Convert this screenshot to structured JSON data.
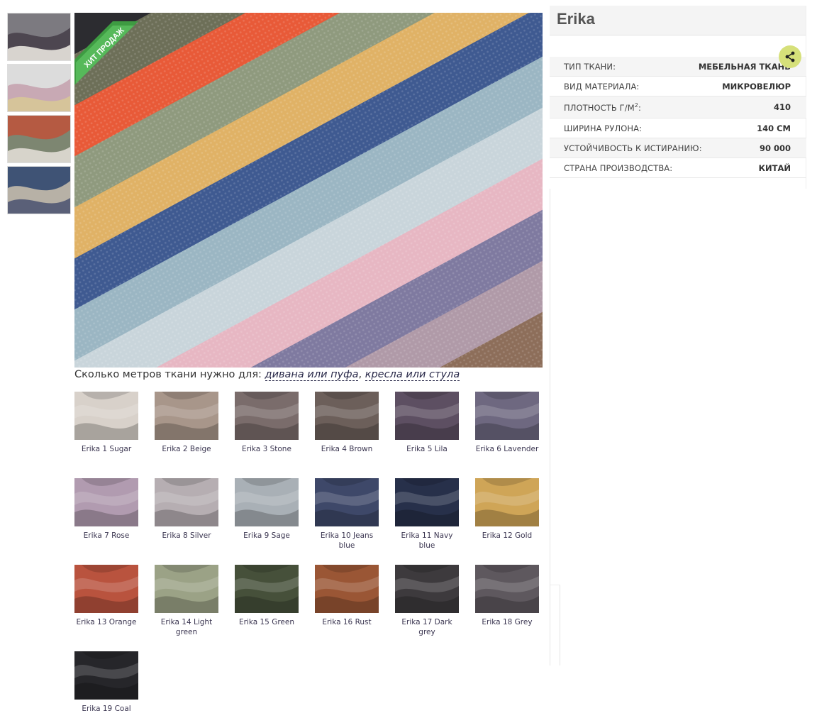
{
  "product": {
    "title": "Erika",
    "badge": "ХИТ ПРОДАЖ",
    "share_icon": "share-icon"
  },
  "thumbnails": [
    {
      "name": "thumb-1",
      "colors": [
        "#7c7a80",
        "#4d4650",
        "#d8d4cf"
      ]
    },
    {
      "name": "thumb-2",
      "colors": [
        "#dcdcdc",
        "#c8a9b4",
        "#d6c49a"
      ]
    },
    {
      "name": "thumb-3",
      "colors": [
        "#b55a42",
        "#7d8671",
        "#d7d4cb"
      ]
    },
    {
      "name": "thumb-4",
      "colors": [
        "#3f5375",
        "#b7b1a6",
        "#5a6078"
      ]
    }
  ],
  "main_stripes": [
    "#6d6f58",
    "#e85a38",
    "#8f9a7e",
    "#e0b266",
    "#3f5a91",
    "#9bb6c3",
    "#c9d5db",
    "#e7b7c3",
    "#7f7aa0",
    "#b09aa8",
    "#8d6e5a"
  ],
  "calculator": {
    "prefix": "Сколько метров ткани нужно для:",
    "link1": "дивана или пуфа",
    "separator": ",",
    "link2": "кресла или стула"
  },
  "swatches": [
    {
      "label": "Erika 1 Sugar",
      "color": "#d8d1ca"
    },
    {
      "label": "Erika 2 Beige",
      "color": "#a8968a"
    },
    {
      "label": "Erika 3 Stone",
      "color": "#7a6c6b"
    },
    {
      "label": "Erika 4 Brown",
      "color": "#6c5f5a"
    },
    {
      "label": "Erika 5 Lila",
      "color": "#5d4f62"
    },
    {
      "label": "Erika 6 Lavender",
      "color": "#6e6880"
    },
    {
      "label": "Erika 7 Rose",
      "color": "#b19bb0"
    },
    {
      "label": "Erika 8 Silver",
      "color": "#b6aeb2"
    },
    {
      "label": "Erika 9 Sage",
      "color": "#a9b0b6"
    },
    {
      "label": "Erika 10 Jeans blue",
      "color": "#3e4869"
    },
    {
      "label": "Erika 11 Navy blue",
      "color": "#27304a"
    },
    {
      "label": "Erika 12 Gold",
      "color": "#cfa557"
    },
    {
      "label": "Erika 13 Orange",
      "color": "#b9533e"
    },
    {
      "label": "Erika 14 Light green",
      "color": "#9ba286"
    },
    {
      "label": "Erika 15 Green",
      "color": "#46503a"
    },
    {
      "label": "Erika 16 Rust",
      "color": "#9a5635"
    },
    {
      "label": "Erika 17 Dark grey",
      "color": "#3d3a3d"
    },
    {
      "label": "Erika 18 Grey",
      "color": "#5e585e"
    },
    {
      "label": "Erika 19 Coal",
      "color": "#26262a"
    }
  ],
  "specs": [
    {
      "key": "ТИП ТКАНИ:",
      "value": "МЕБЕЛЬНАЯ ТКАНЬ"
    },
    {
      "key": "ВИД МАТЕРИАЛА:",
      "value": "МИКРОВЕЛЮР"
    },
    {
      "key": "ПЛОТНОСТЬ Г/М",
      "key_sup": "2",
      "key_tail": ":",
      "value": "410"
    },
    {
      "key": "ШИРИНА РУЛОНА:",
      "value": "140 СМ"
    },
    {
      "key": "УСТОЙЧИВОСТЬ К ИСТИРАНИЮ:",
      "value": "90 000"
    },
    {
      "key": "СТРАНА ПРОИЗВОДСТВА:",
      "value": "КИТАЙ"
    }
  ],
  "colors": {
    "badge": "#4caf50",
    "share_bg": "#d6e07a",
    "link": "#2a2a4a"
  }
}
